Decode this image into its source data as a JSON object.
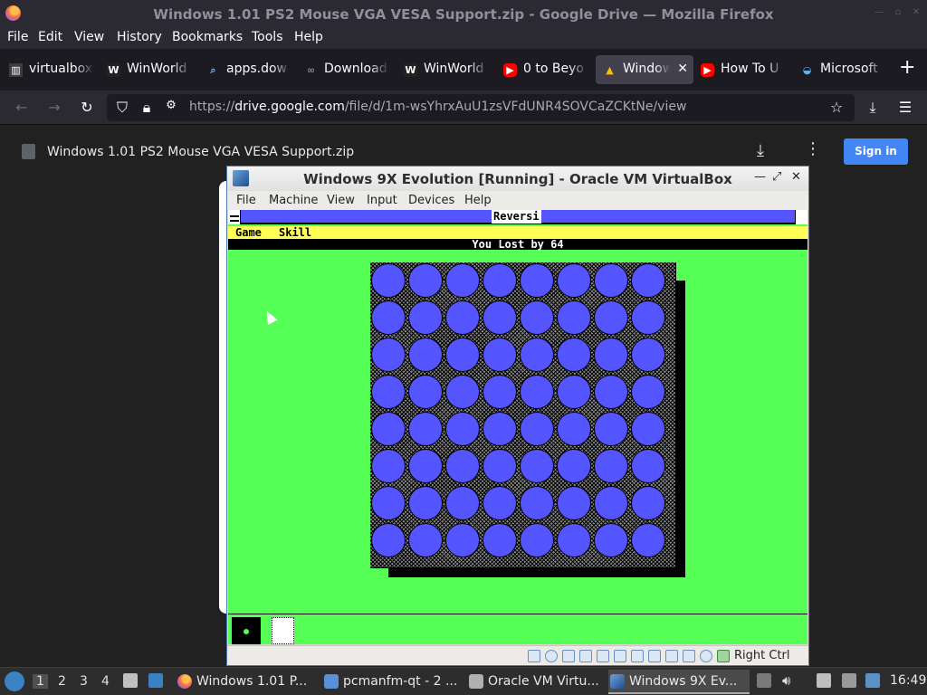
{
  "browser": {
    "window_title": "Windows 1.01 PS2 Mouse VGA VESA Support.zip - Google Drive — Mozilla Firefox",
    "menu": [
      "File",
      "Edit",
      "View",
      "History",
      "Bookmarks",
      "Tools",
      "Help"
    ],
    "tabs": [
      {
        "label": "virtualbox",
        "icon": "museum-icon",
        "color": "#3d3d3d"
      },
      {
        "label": "WinWorld",
        "icon": "winworld-icon",
        "color": "#222222"
      },
      {
        "label": "apps.dow",
        "icon": "search-icon",
        "color": "#2b2a33"
      },
      {
        "label": "Download",
        "icon": "download-site-icon",
        "color": "#2b2a33"
      },
      {
        "label": "WinWorld",
        "icon": "winworld-icon",
        "color": "#222222"
      },
      {
        "label": "0 to Beyo",
        "icon": "youtube-icon",
        "color": "#ff0000"
      },
      {
        "label": "Window",
        "icon": "google-drive-icon",
        "color": "#1fa463",
        "active": true
      },
      {
        "label": "How To U",
        "icon": "youtube-icon",
        "color": "#ff0000"
      },
      {
        "label": "Microsoft",
        "icon": "edge-icon",
        "color": "#2f7fd1"
      }
    ],
    "url": "https://drive.google.com/file/d/1m-wsYhrxAuU1zsVFdUNR4SOVCaZCKtNe/view",
    "url_host": "drive.google.com",
    "url_prefix": "https://",
    "url_path": "/file/d/1m-wsYhrxAuU1zsVFdUNR4SOVCaZCKtNe/view"
  },
  "drive": {
    "file_name": "Windows 1.01 PS2 Mouse VGA VESA Support.zip",
    "sign_in_label": "Sign in"
  },
  "vbox": {
    "title": "Windows 9X Evolution [Running] - Oracle VM VirtualBox",
    "menu": [
      "File",
      "Machine",
      "View",
      "Input",
      "Devices",
      "Help"
    ],
    "host_key": "Right Ctrl"
  },
  "reversi": {
    "title": "Reversi",
    "menu": [
      "Game",
      "Skill"
    ],
    "status": "You Lost by 64",
    "board_rows": 8,
    "board_cols": 8,
    "piece_color": "#5555ff"
  },
  "taskbar": {
    "workspaces": [
      "1",
      "2",
      "3",
      "4"
    ],
    "active_workspace": "1",
    "items": [
      {
        "label": "Windows 1.01 P...",
        "icon": "firefox-icon"
      },
      {
        "label": "pcmanfm-qt - 2 ...",
        "icon": "folder-icon"
      },
      {
        "label": "Oracle VM Virtu...",
        "icon": "virtualbox-icon"
      },
      {
        "label": "Windows 9X Ev...",
        "icon": "virtualbox-vm-icon",
        "active": true
      }
    ],
    "clock": "16:49"
  }
}
